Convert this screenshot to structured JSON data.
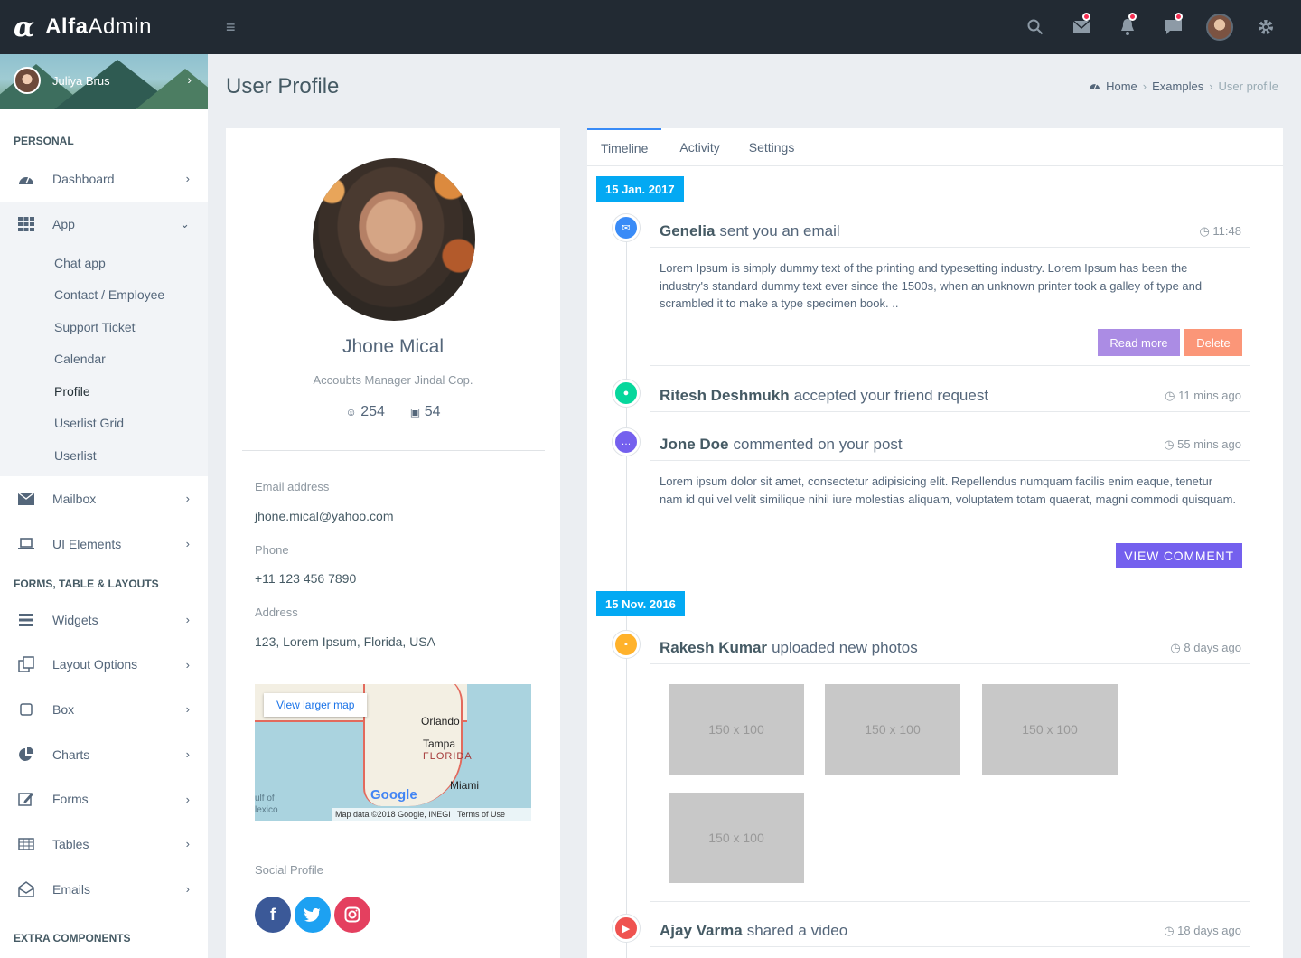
{
  "brand": {
    "first": "Alfa",
    "second": "Admin"
  },
  "sidebar": {
    "user_name": "Juliya Brus",
    "personal_title": "PERSONAL",
    "forms_title": "FORMS, TABLE & LAYOUTS",
    "extra_title": "EXTRA COMPONENTS",
    "items": {
      "dashboard": "Dashboard",
      "app": "App",
      "mailbox": "Mailbox",
      "ui_elements": "UI Elements",
      "widgets": "Widgets",
      "layout_options": "Layout Options",
      "box": "Box",
      "charts": "Charts",
      "forms": "Forms",
      "tables": "Tables",
      "emails": "Emails"
    },
    "app_sub": [
      "Chat app",
      "Contact / Employee",
      "Support Ticket",
      "Calendar",
      "Profile",
      "Userlist Grid",
      "Userlist"
    ]
  },
  "page": {
    "title": "User Profile",
    "breadcrumb": [
      "Home",
      "Examples",
      "User profile"
    ]
  },
  "profile": {
    "name": "Jhone Mical",
    "role": "Accoubts Manager Jindal Cop.",
    "followers": "254",
    "photos": "54",
    "email_label": "Email address",
    "email": "jhone.mical@yahoo.com",
    "phone_label": "Phone",
    "phone": "+11 123 456 7890",
    "address_label": "Address",
    "address": "123, Lorem Ipsum, Florida, USA",
    "map": {
      "view_larger": "View larger map",
      "cities": [
        "Orlando",
        "Tampa",
        "FLORIDA",
        "Miami"
      ],
      "gulf": "ulf of\nlexico",
      "google": "Google",
      "footer": "Map data ©2018 Google, INEGI   Terms of Use"
    },
    "social_label": "Social Profile"
  },
  "timeline": {
    "tabs": [
      "Timeline",
      "Activity",
      "Settings"
    ],
    "dates": [
      "15 Jan. 2017",
      "15 Nov. 2016"
    ],
    "items": [
      {
        "name": "Genelia",
        "action": "sent you an email",
        "time": "11:48",
        "color": "#398bf7",
        "body": "Lorem Ipsum is simply dummy text of the printing and typesetting industry. Lorem Ipsum has been the industry's standard dummy text ever since the 1500s, when an unknown printer took a galley of type and scrambled it to make a type specimen book. ..",
        "btn1": "Read more",
        "btn2": "Delete"
      },
      {
        "name": "Ritesh Deshmukh",
        "action": "accepted your friend request",
        "time": "11 mins ago",
        "color": "#06d79c"
      },
      {
        "name": "Jone Doe",
        "action": "commented on your post",
        "time": "55 mins ago",
        "color": "#7460ee",
        "body": "Lorem ipsum dolor sit amet, consectetur adipisicing elit. Repellendus numquam facilis enim eaque, tenetur nam id qui vel velit similique nihil iure molestias aliquam, voluptatem totam quaerat, magni commodi quisquam.",
        "btn": "VIEW COMMENT"
      },
      {
        "name": "Rakesh Kumar",
        "action": "uploaded new photos",
        "time": "8 days ago",
        "color": "#ffb22b",
        "photos": [
          "150 x 100",
          "150 x 100",
          "150 x 100",
          "150 x 100"
        ]
      },
      {
        "name": "Ajay Varma",
        "action": "shared a video",
        "time": "18 days ago",
        "color": "#ef5350"
      }
    ]
  }
}
